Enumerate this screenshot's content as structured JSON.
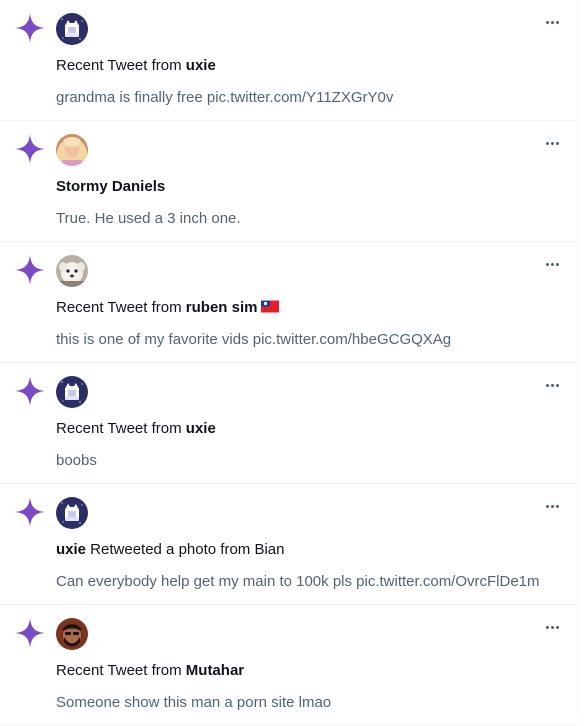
{
  "feed": {
    "items": [
      {
        "type": "recent_tweet",
        "prefix": "Recent Tweet from ",
        "name": "uxie",
        "text": "grandma is finally free pic.twitter.com/Y11ZXGrY0v",
        "avatar_icon": "cat-cup-icon"
      },
      {
        "type": "name_only",
        "name": "Stormy Daniels",
        "text": "True. He used a 3 inch one.",
        "avatar_icon": "blonde-person-icon"
      },
      {
        "type": "recent_tweet",
        "prefix": "Recent Tweet from ",
        "name": "ruben sim",
        "flag_icon": "taiwan-flag-icon",
        "text": "this is one of my favorite vids pic.twitter.com/hbeGCGQXAg",
        "avatar_icon": "white-dog-icon"
      },
      {
        "type": "recent_tweet",
        "prefix": "Recent Tweet from ",
        "name": "uxie",
        "text": "boobs",
        "avatar_icon": "cat-cup-icon"
      },
      {
        "type": "retweet",
        "name": "uxie",
        "suffix": " Retweeted a photo from Bian",
        "text": "Can everybody help get my main to 100k pls pic.twitter.com/OvrcFlDe1m",
        "avatar_icon": "cat-cup-icon"
      },
      {
        "type": "recent_tweet",
        "prefix": "Recent Tweet from ",
        "name": "Mutahar",
        "text": "Someone show this man a porn site lmao",
        "avatar_icon": "bearded-man-icon"
      }
    ]
  },
  "colors": {
    "sparkle": "#794bc4",
    "secondary_text": "#536471",
    "primary_text": "#0f1419",
    "divider": "#eff3f4"
  }
}
